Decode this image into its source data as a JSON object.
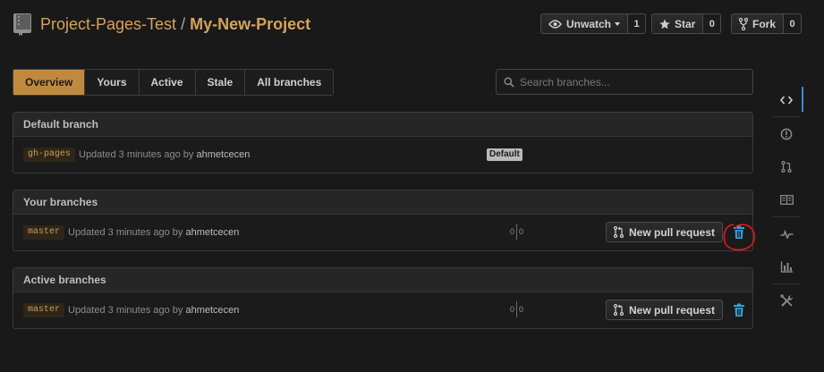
{
  "repo": {
    "owner": "Project-Pages-Test",
    "separator": "/",
    "name": "My-New-Project"
  },
  "social": {
    "watch_label": "Unwatch",
    "watch_count": "1",
    "star_label": "Star",
    "star_count": "0",
    "fork_label": "Fork",
    "fork_count": "0"
  },
  "tabs": [
    {
      "label": "Overview",
      "selected": true
    },
    {
      "label": "Yours",
      "selected": false
    },
    {
      "label": "Active",
      "selected": false
    },
    {
      "label": "Stale",
      "selected": false
    },
    {
      "label": "All branches",
      "selected": false
    }
  ],
  "search": {
    "placeholder": "Search branches..."
  },
  "sections": {
    "default": {
      "title": "Default branch",
      "branch": "gh-pages",
      "updated": "Updated 3 minutes ago by",
      "author": "ahmetcecen",
      "badge": "Default"
    },
    "yours": {
      "title": "Your branches",
      "branch": "master",
      "updated": "Updated 3 minutes ago by",
      "author": "ahmetcecen",
      "behind": "0",
      "ahead": "0",
      "pr_label": "New pull request"
    },
    "active": {
      "title": "Active branches",
      "branch": "master",
      "updated": "Updated 3 minutes ago by",
      "author": "ahmetcecen",
      "behind": "0",
      "ahead": "0",
      "pr_label": "New pull request"
    }
  },
  "sidebar": {
    "items": [
      "code-icon",
      "issues-icon",
      "pull-request-icon",
      "wiki-icon",
      "pulse-icon",
      "graphs-icon",
      "settings-icon"
    ],
    "active": "code-icon"
  },
  "colors": {
    "accent": "#c08a3e",
    "link": "#d4a35c",
    "trash": "#3aa0d8",
    "annotation": "#e0191b",
    "sidebar_active": "#3c8ad8"
  }
}
